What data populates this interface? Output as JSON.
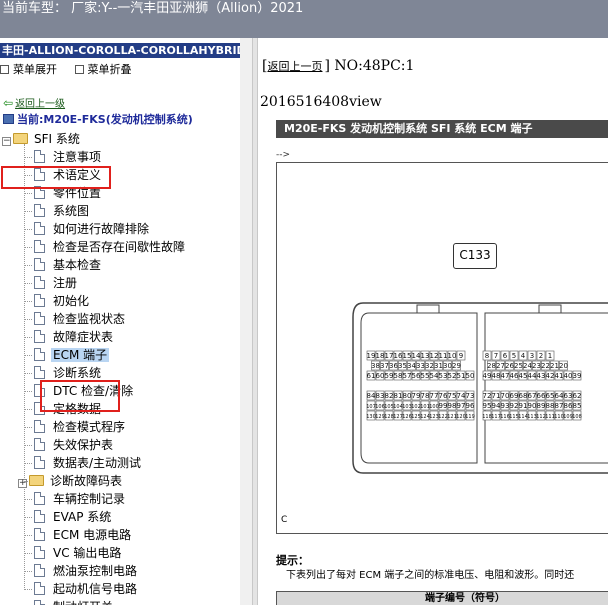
{
  "titlebar": {
    "text": "当前车型：  厂家:Y--一汽丰田亚洲狮（Allion）2021"
  },
  "left_panel": {
    "header": "丰田-ALLION-COROLLA-COROLLAHYBRID-",
    "expand_label": "菜单展开",
    "collapse_label": "菜单折叠",
    "back_link": "返回上一级",
    "current": "当前:M20E-FKS(发动机控制系统)"
  },
  "tree": {
    "root_label": "SFI 系统",
    "items": [
      {
        "label": "注意事项"
      },
      {
        "label": "术语定义"
      },
      {
        "label": "零件位置"
      },
      {
        "label": "系统图"
      },
      {
        "label": "如何进行故障排除"
      },
      {
        "label": "检查是否存在间歇性故障"
      },
      {
        "label": "基本检查"
      },
      {
        "label": "注册"
      },
      {
        "label": "初始化"
      },
      {
        "label": "检查监视状态"
      },
      {
        "label": "故障症状表"
      },
      {
        "label": "ECM 端子"
      },
      {
        "label": "诊断系统"
      },
      {
        "label": "DTC 检查/清除"
      },
      {
        "label": "定格数据"
      },
      {
        "label": "检查模式程序"
      },
      {
        "label": "失效保护表"
      },
      {
        "label": "数据表/主动测试"
      },
      {
        "label": "诊断故障码表"
      },
      {
        "label": "车辆控制记录"
      },
      {
        "label": "EVAP 系统"
      },
      {
        "label": "ECM 电源电路"
      },
      {
        "label": "VC 输出电路"
      },
      {
        "label": "燃油泵控制电路"
      },
      {
        "label": "起动机信号电路"
      },
      {
        "label": "制动灯开关"
      }
    ]
  },
  "right_panel": {
    "back_link": "返回上一页",
    "nav_text": "NO:48PC:1",
    "view_id": "2016516408view",
    "doc_title": "M20E-FKS 发动机控制系统  SFI 系统  ECM 端子",
    "marker": "-->",
    "connector_label": "C133",
    "figure_code": "C",
    "hint_title": "提示：",
    "hint_text": "下表列出了每对 ECM 端子之间的标准电压、电阻和波形。同时还",
    "table_header": "端子编号（符号）"
  },
  "connector": {
    "left_rows": [
      [
        "19",
        "18",
        "17",
        "16",
        "15",
        "14",
        "13",
        "12",
        "11",
        "10",
        "9"
      ],
      [
        "38",
        "37",
        "36",
        "35",
        "34",
        "33",
        "32",
        "31",
        "30",
        "29"
      ],
      [
        "61",
        "60",
        "59",
        "58",
        "57",
        "56",
        "55",
        "54",
        "53",
        "52",
        "51",
        "50"
      ],
      [
        "84",
        "83",
        "82",
        "81",
        "80",
        "79",
        "78",
        "77",
        "76",
        "75",
        "74",
        "73"
      ],
      [
        "107",
        "106",
        "105",
        "104",
        "103",
        "102",
        "101",
        "100",
        "99",
        "98",
        "97",
        "96"
      ],
      [
        "130",
        "129",
        "128",
        "127",
        "126",
        "125",
        "124",
        "123",
        "122",
        "121",
        "120",
        "119"
      ]
    ],
    "right_rows": [
      [
        "8",
        "7",
        "6",
        "5",
        "4",
        "3",
        "2",
        "1"
      ],
      [
        "28",
        "27",
        "26",
        "25",
        "24",
        "23",
        "22",
        "21",
        "20"
      ],
      [
        "49",
        "48",
        "47",
        "46",
        "45",
        "44",
        "43",
        "42",
        "41",
        "40",
        "39"
      ],
      [
        "72",
        "71",
        "70",
        "69",
        "68",
        "67",
        "66",
        "65",
        "64",
        "63",
        "62"
      ],
      [
        "95",
        "94",
        "93",
        "92",
        "91",
        "90",
        "89",
        "88",
        "87",
        "86",
        "85"
      ],
      [
        "118",
        "117",
        "116",
        "115",
        "114",
        "113",
        "112",
        "111",
        "110",
        "109",
        "108"
      ]
    ]
  }
}
